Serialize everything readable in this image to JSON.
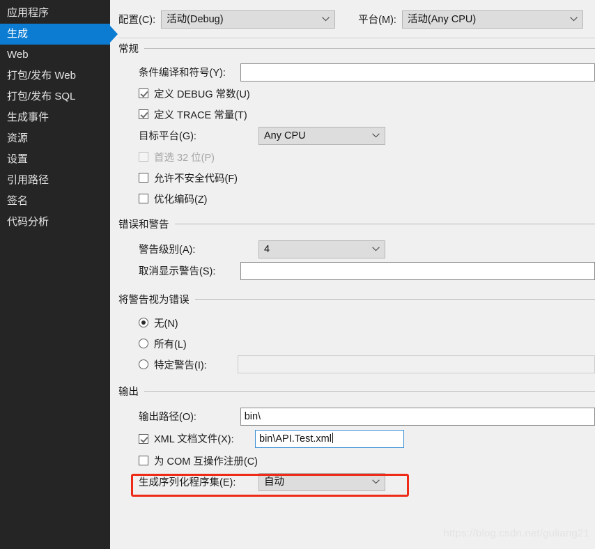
{
  "sidebar": {
    "items": [
      {
        "label": "应用程序",
        "selected": false
      },
      {
        "label": "生成",
        "selected": true
      },
      {
        "label": "Web",
        "selected": false
      },
      {
        "label": "打包/发布 Web",
        "selected": false
      },
      {
        "label": "打包/发布 SQL",
        "selected": false
      },
      {
        "label": "生成事件",
        "selected": false
      },
      {
        "label": "资源",
        "selected": false
      },
      {
        "label": "设置",
        "selected": false
      },
      {
        "label": "引用路径",
        "selected": false
      },
      {
        "label": "签名",
        "selected": false
      },
      {
        "label": "代码分析",
        "selected": false
      }
    ]
  },
  "top": {
    "configuration_label": "配置(C):",
    "configuration_value": "活动(Debug)",
    "platform_label": "平台(M):",
    "platform_value": "活动(Any CPU)"
  },
  "general": {
    "header": "常规",
    "cond_symbols_label": "条件编译和符号(Y):",
    "cond_symbols_value": "",
    "define_debug_label": "定义 DEBUG 常数(U)",
    "define_debug_checked": true,
    "define_trace_label": "定义 TRACE 常量(T)",
    "define_trace_checked": true,
    "target_platform_label": "目标平台(G):",
    "target_platform_value": "Any CPU",
    "prefer32_label": "首选 32 位(P)",
    "prefer32_checked": false,
    "unsafe_label": "允许不安全代码(F)",
    "unsafe_checked": false,
    "optimize_label": "优化编码(Z)",
    "optimize_checked": false
  },
  "errors": {
    "header": "错误和警告",
    "warning_level_label": "警告级别(A):",
    "warning_level_value": "4",
    "suppress_label": "取消显示警告(S):",
    "suppress_value": ""
  },
  "warnings_as_errors": {
    "header": "将警告视为错误",
    "none_label": "无(N)",
    "all_label": "所有(L)",
    "specific_label": "特定警告(I):",
    "specific_value": "",
    "selected": "none"
  },
  "output": {
    "header": "输出",
    "output_path_label": "输出路径(O):",
    "output_path_value": "bin\\",
    "xml_doc_label": "XML 文档文件(X):",
    "xml_doc_checked": true,
    "xml_doc_value": "bin\\API.Test.xml",
    "com_interop_label": "为 COM 互操作注册(C)",
    "com_interop_checked": false,
    "serialization_label": "生成序列化程序集(E):",
    "serialization_value": "自动"
  },
  "annotation": {
    "highlight_color": "#ee2b17"
  },
  "watermark": {
    "text": "https://blog.csdn.net/guliang21"
  }
}
